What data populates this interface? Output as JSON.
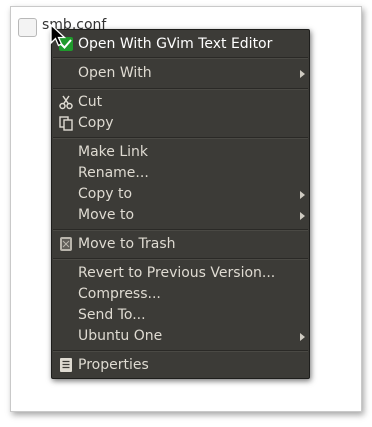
{
  "desktop": {
    "file": {
      "name": "smb.conf"
    }
  },
  "context_menu": {
    "items": [
      {
        "label": "Open With GVim Text Editor",
        "icon": "gvim-icon",
        "submenu": false
      },
      {
        "label": "Open With",
        "icon": "",
        "submenu": true
      },
      {
        "label": "Cut",
        "icon": "scissors-icon",
        "submenu": false
      },
      {
        "label": "Copy",
        "icon": "copy-icon",
        "submenu": false
      },
      {
        "label": "Make Link",
        "icon": "",
        "submenu": false
      },
      {
        "label": "Rename...",
        "icon": "",
        "submenu": false
      },
      {
        "label": "Copy to",
        "icon": "",
        "submenu": true
      },
      {
        "label": "Move to",
        "icon": "",
        "submenu": true
      },
      {
        "label": "Move to Trash",
        "icon": "trash-icon",
        "submenu": false
      },
      {
        "label": "Revert to Previous Version...",
        "icon": "",
        "submenu": false
      },
      {
        "label": "Compress...",
        "icon": "",
        "submenu": false
      },
      {
        "label": "Send To...",
        "icon": "",
        "submenu": false
      },
      {
        "label": "Ubuntu One",
        "icon": "",
        "submenu": true
      },
      {
        "label": "Properties",
        "icon": "properties-icon",
        "submenu": false
      }
    ]
  },
  "colors": {
    "menu_bg": "#3c3b37",
    "menu_text": "#dfdbd2",
    "gvim_green": "#1f9a2c"
  }
}
